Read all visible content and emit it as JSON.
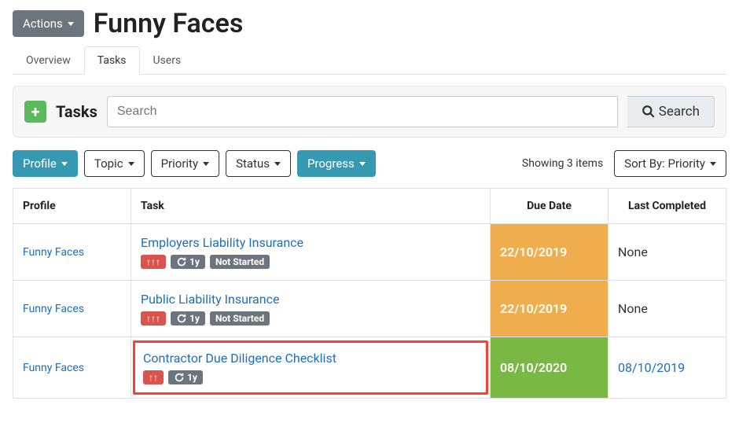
{
  "header": {
    "actions_label": "Actions",
    "title": "Funny Faces"
  },
  "tabs": [
    "Overview",
    "Tasks",
    "Users"
  ],
  "active_tab": "Tasks",
  "search_panel": {
    "label": "Tasks",
    "placeholder": "Search",
    "button_label": "Search"
  },
  "filters": {
    "profile": "Profile",
    "topic": "Topic",
    "priority": "Priority",
    "status": "Status",
    "progress": "Progress"
  },
  "showing_text": "Showing 3 items",
  "sort_label": "Sort By: Priority",
  "table": {
    "headers": {
      "profile": "Profile",
      "task": "Task",
      "due": "Due Date",
      "last": "Last Completed"
    },
    "rows": [
      {
        "profile": "Funny Faces",
        "task": "Employers Liability Insurance",
        "priority_arrows": 3,
        "cycle": "1y",
        "status": "Not Started",
        "due": "22/10/2019",
        "due_color": "orange",
        "last": "None",
        "last_link": false,
        "highlight": false
      },
      {
        "profile": "Funny Faces",
        "task": "Public Liability Insurance",
        "priority_arrows": 3,
        "cycle": "1y",
        "status": "Not Started",
        "due": "22/10/2019",
        "due_color": "orange",
        "last": "None",
        "last_link": false,
        "highlight": false
      },
      {
        "profile": "Funny Faces",
        "task": "Contractor Due Diligence Checklist",
        "priority_arrows": 2,
        "cycle": "1y",
        "status": null,
        "due": "08/10/2020",
        "due_color": "green",
        "last": "08/10/2019",
        "last_link": true,
        "highlight": true
      }
    ]
  }
}
